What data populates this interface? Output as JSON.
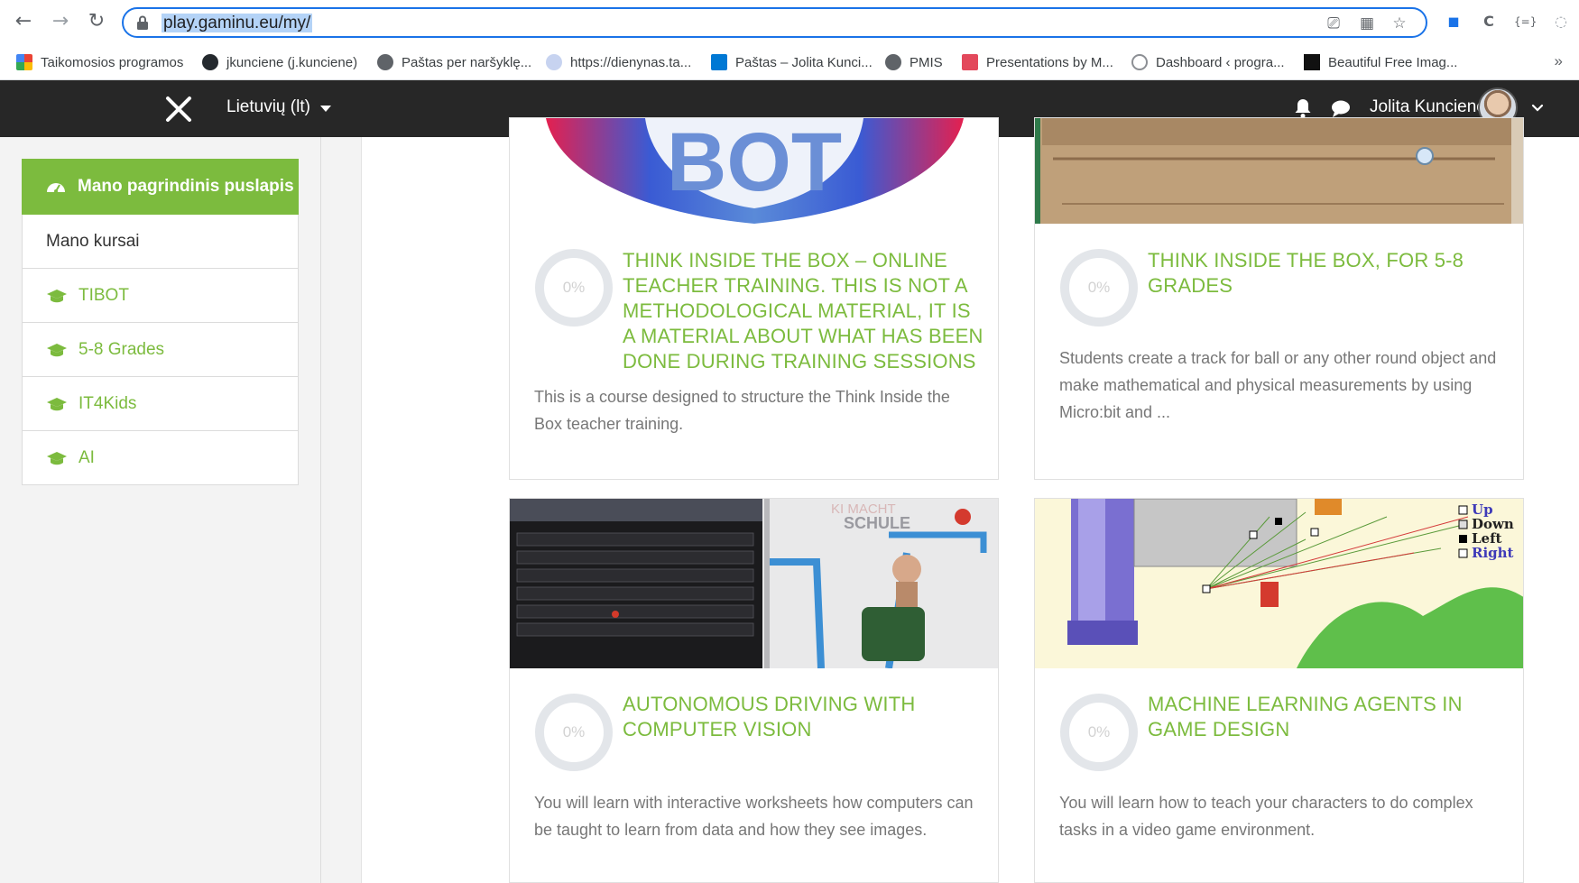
{
  "browser": {
    "url_text": "play.gaminu.eu/my/",
    "nav": {
      "back": "←",
      "forward": "→",
      "reload": "↻"
    },
    "bookmarks": [
      {
        "label": "Taikomosios programos",
        "icon": "apps-grid-icon",
        "color": "#ea4335"
      },
      {
        "label": "jkunciene (j.kunciene)",
        "icon": "github-icon",
        "color": "#24292e"
      },
      {
        "label": "Paštas per naršyklę...",
        "icon": "globe-icon",
        "color": "#5f6368"
      },
      {
        "label": "https://dienynas.ta...",
        "icon": "dienynas-icon",
        "color": "#8ab4f8"
      },
      {
        "label": "Paštas – Jolita Kunci...",
        "icon": "outlook-icon",
        "color": "#0078d4"
      },
      {
        "label": "PMIS",
        "icon": "globe-icon",
        "color": "#5f6368"
      },
      {
        "label": "Presentations by M...",
        "icon": "slides-s-icon",
        "color": "#e3485b"
      },
      {
        "label": "Dashboard ‹ progra...",
        "icon": "wordpress-icon",
        "color": "#8c8f94"
      },
      {
        "label": "Beautiful Free Imag...",
        "icon": "unsplash-icon",
        "color": "#111111"
      }
    ],
    "more": "»"
  },
  "header": {
    "language": "Lietuvių (lt)",
    "user_name": "Jolita Kuncienė"
  },
  "sidebar": {
    "items": [
      {
        "label": "Mano pagrindinis puslapis",
        "type": "active"
      },
      {
        "label": "Mano kursai",
        "type": "plain"
      },
      {
        "label": "TIBOT",
        "type": "course"
      },
      {
        "label": "5-8 Grades",
        "type": "course"
      },
      {
        "label": "IT4Kids",
        "type": "course"
      },
      {
        "label": "AI",
        "type": "course"
      }
    ]
  },
  "courses": [
    {
      "title": "THINK INSIDE THE BOX – ONLINE TEACHER TRAINING. THIS IS NOT A METHODOLOGICAL MATERIAL, IT IS A MATERIAL ABOUT WHAT HAS BEEN DONE DURING TRAINING SESSIONS",
      "description": "This is a course designed to structure the Think Inside the Box teacher training.",
      "progress": "0%",
      "progress_value": 0
    },
    {
      "title": "THINK INSIDE THE BOX, FOR 5-8 GRADES",
      "description": "Students create a track for ball or any other round object and make mathematical and physical measurements by using Micro:bit and ...",
      "progress": "0%",
      "progress_value": 0
    },
    {
      "title": "AUTONOMOUS DRIVING WITH COMPUTER VISION",
      "description": "You will learn with interactive worksheets how computers can be taught to learn from data and how they see images.",
      "progress": "0%",
      "progress_value": 0,
      "image_text": "KI MACHT SCHULE"
    },
    {
      "title": "MACHINE LEARNING AGENTS IN GAME DESIGN",
      "description": "You will learn how to teach your characters to do complex tasks in a video game environment.",
      "progress": "0%",
      "progress_value": 0,
      "image_legend": [
        "Up",
        "Down",
        "Left",
        "Right"
      ]
    }
  ],
  "colors": {
    "accent": "#7cbb3e",
    "header_bg": "#272727",
    "focus_blue": "#1a73e8"
  }
}
